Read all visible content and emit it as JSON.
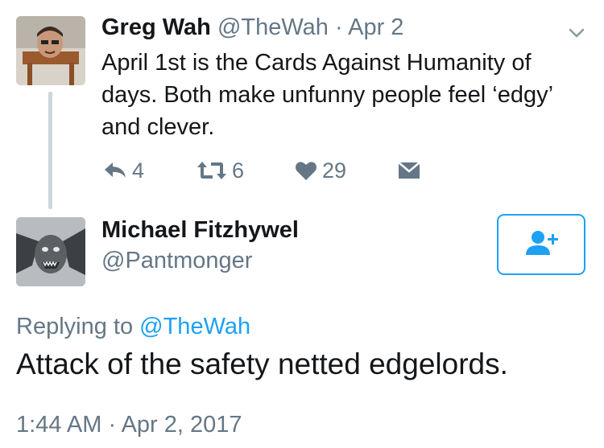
{
  "parent_tweet": {
    "author_name": "Greg Wah",
    "handle": "@TheWah",
    "separator": "·",
    "date": "Apr 2",
    "text": "April 1st is the Cards Against Humanity of days. Both make unfunny people feel ‘edgy’ and clever.",
    "replies_count": "4",
    "retweets_count": "6",
    "likes_count": "29",
    "icons": [
      "reply-icon",
      "retweet-icon",
      "heart-icon",
      "message-icon",
      "chevron-down-icon"
    ]
  },
  "reply_tweet": {
    "author_name": "Michael Fitzhywel",
    "handle": "@Pantmonger",
    "replying_prefix": "Replying to",
    "replying_to": "@TheWah",
    "text": "Attack of the safety netted edgelords.",
    "timestamp": "1:44 AM · Apr 2, 2017",
    "follow_icon": "add-user-icon"
  },
  "colors": {
    "accent": "#1da1f2",
    "muted": "#657786",
    "text": "#14171a",
    "thread_line": "#ccd6dd"
  }
}
